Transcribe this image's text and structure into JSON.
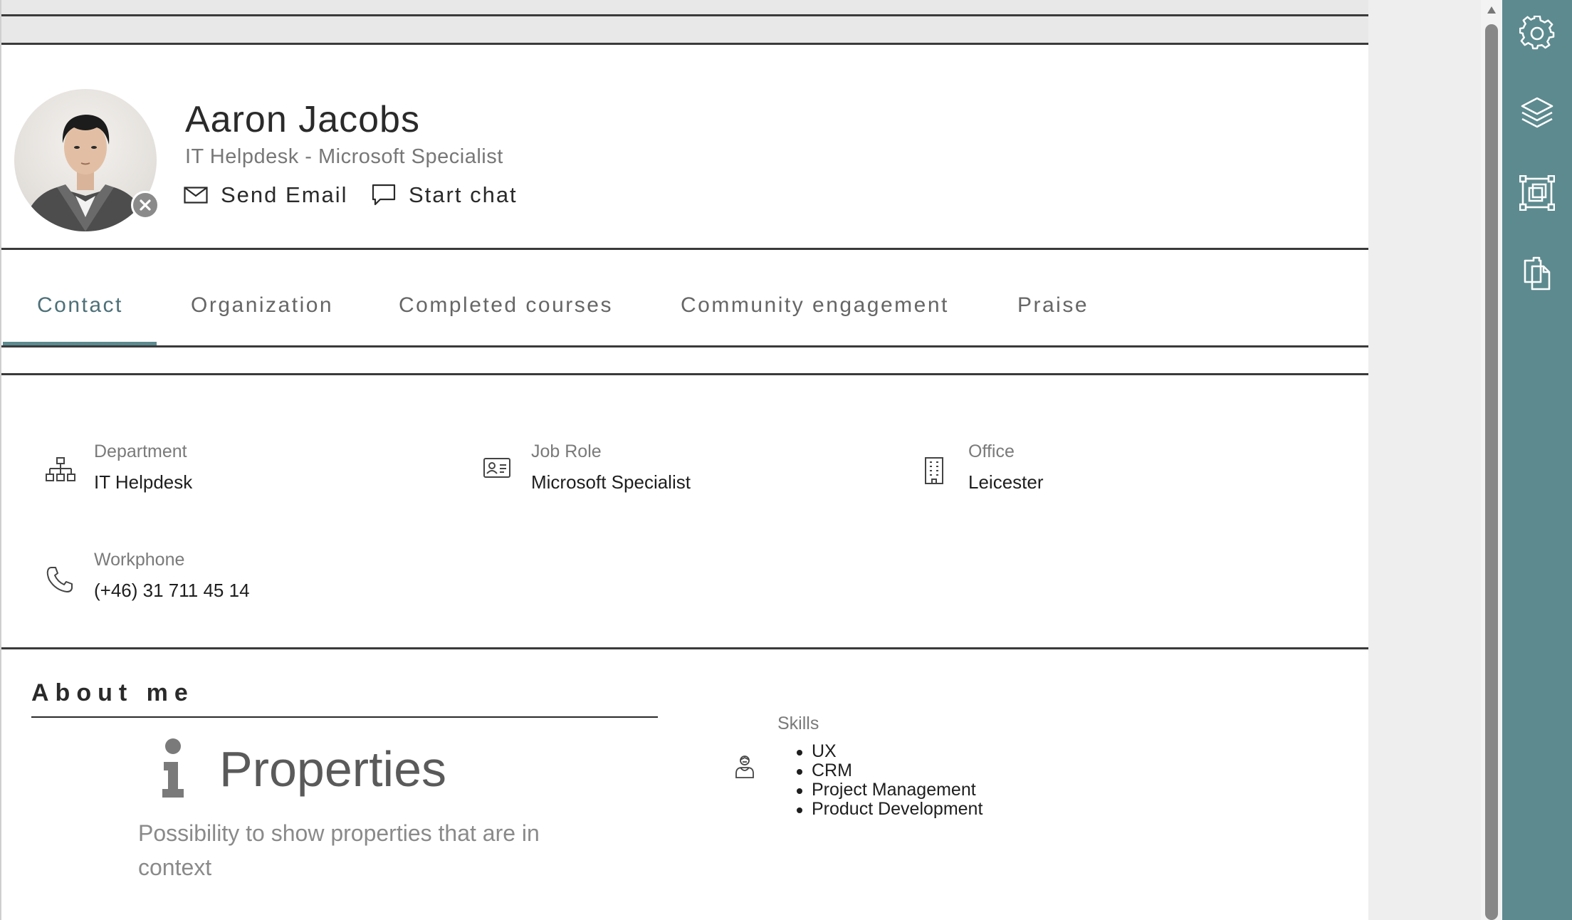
{
  "profile": {
    "name": "Aaron Jacobs",
    "title": "IT Helpdesk - Microsoft Specialist",
    "actions": {
      "email_label": "Send Email",
      "chat_label": "Start chat"
    }
  },
  "tabs": [
    {
      "label": "Contact",
      "active": true
    },
    {
      "label": "Organization",
      "active": false
    },
    {
      "label": "Completed courses",
      "active": false
    },
    {
      "label": "Community engagement",
      "active": false
    },
    {
      "label": "Praise",
      "active": false
    }
  ],
  "contact_fields": [
    {
      "label": "Department",
      "value": "IT Helpdesk",
      "icon": "org-chart-icon"
    },
    {
      "label": "Job Role",
      "value": "Microsoft Specialist",
      "icon": "id-card-icon"
    },
    {
      "label": "Office",
      "value": "Leicester",
      "icon": "building-icon"
    },
    {
      "label": "Workphone",
      "value": "(+46) 31 711 45 14",
      "icon": "phone-icon"
    }
  ],
  "about": {
    "heading": "About me",
    "properties_title": "Properties",
    "properties_description": "Possibility to show properties that are in context",
    "skills_label": "Skills",
    "skills": [
      "UX",
      "CRM",
      "Project Management",
      "Product Development"
    ]
  },
  "tool_rail": {
    "icons": [
      "gear-icon",
      "layers-icon",
      "frame-select-icon",
      "clipboard-copy-icon"
    ]
  },
  "colors": {
    "accent": "#5c8a8f",
    "active_tab_text": "#4d7078",
    "rule": "#3a3a3a"
  }
}
